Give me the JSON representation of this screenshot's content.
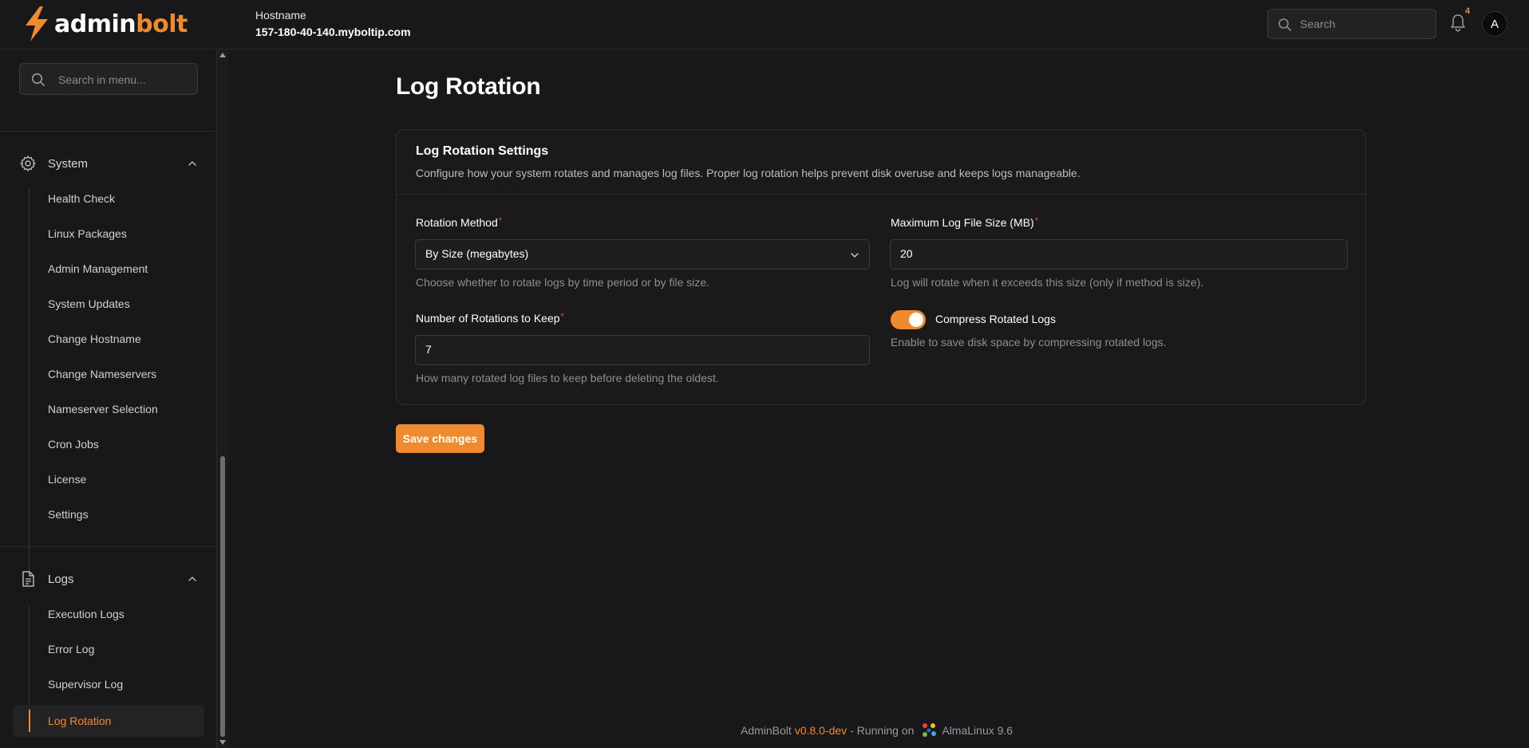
{
  "brand": {
    "name_part1": "admin",
    "name_part2": "bolt",
    "accent": "#f08a2e"
  },
  "header": {
    "hostname_label": "Hostname",
    "hostname_value": "157-180-40-140.myboltip.com",
    "search_placeholder": "Search",
    "notification_count": "4",
    "avatar_initial": "A"
  },
  "sidebar": {
    "search_placeholder": "Search in menu...",
    "groups": [
      {
        "label": "System",
        "icon": "gear-icon",
        "items": [
          "Health Check",
          "Linux Packages",
          "Admin Management",
          "System Updates",
          "Change Hostname",
          "Change Nameservers",
          "Nameserver Selection",
          "Cron Jobs",
          "License",
          "Settings"
        ]
      },
      {
        "label": "Logs",
        "icon": "document-icon",
        "items": [
          "Execution Logs",
          "Error Log",
          "Supervisor Log",
          "Log Rotation"
        ],
        "active": "Log Rotation"
      }
    ]
  },
  "page": {
    "title": "Log Rotation",
    "card": {
      "title": "Log Rotation Settings",
      "description": "Configure how your system rotates and manages log files. Proper log rotation helps prevent disk overuse and keeps logs manageable.",
      "fields": {
        "rotation_method": {
          "label": "Rotation Method",
          "value": "By Size (megabytes)",
          "hint": "Choose whether to rotate logs by time period or by file size."
        },
        "max_size": {
          "label": "Maximum Log File Size (MB)",
          "value": "20",
          "hint": "Log will rotate when it exceeds this size (only if method is size)."
        },
        "rotations": {
          "label": "Number of Rotations to Keep",
          "value": "7",
          "hint": "How many rotated log files to keep before deleting the oldest."
        },
        "compress": {
          "label": "Compress Rotated Logs",
          "enabled": true,
          "hint": "Enable to save disk space by compressing rotated logs."
        }
      },
      "required_marker": "*"
    },
    "save_label": "Save changes"
  },
  "footer": {
    "app": "AdminBolt",
    "version": "v0.8.0-dev",
    "running_on": "- Running on",
    "os": "AlmaLinux 9.6"
  }
}
